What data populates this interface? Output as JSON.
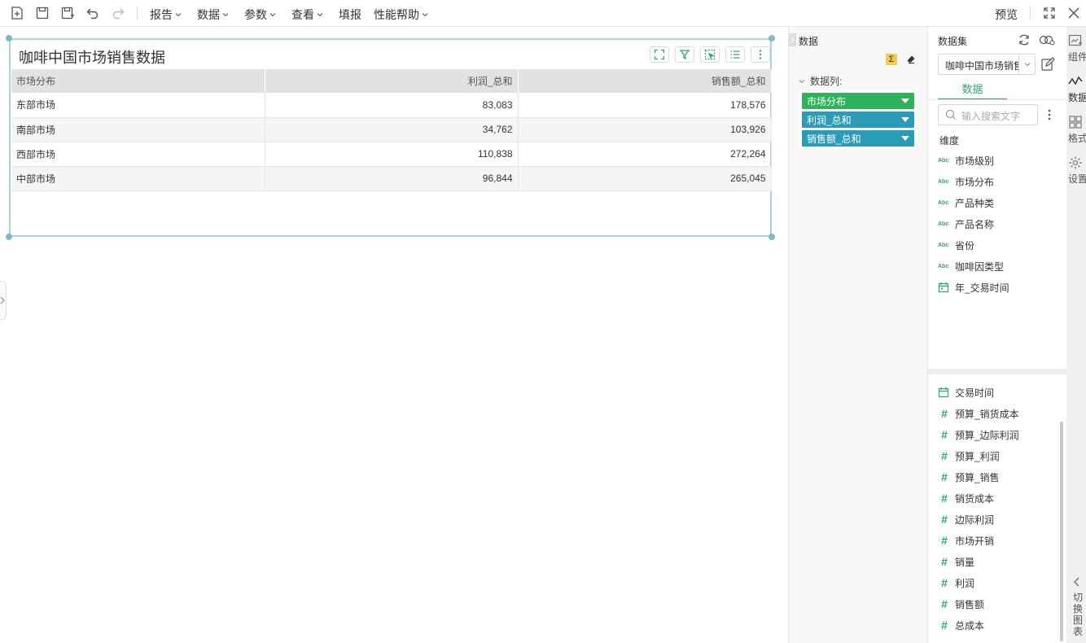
{
  "toolbar": {
    "menus": [
      {
        "label": "报告",
        "has_dropdown": true
      },
      {
        "label": "数据",
        "has_dropdown": true
      },
      {
        "label": "参数",
        "has_dropdown": true
      },
      {
        "label": "查看",
        "has_dropdown": true
      },
      {
        "label": "填报",
        "has_dropdown": false
      },
      {
        "label": "性能帮助",
        "has_dropdown": true
      }
    ],
    "icons": [
      "new-report-icon",
      "save-icon",
      "save-as-icon",
      "undo-icon",
      "redo-icon"
    ],
    "preview_label": "预览",
    "right_icons": [
      "fullscreen-icon",
      "close-icon"
    ]
  },
  "widget": {
    "title": "咖啡中国市场销售数据",
    "tools": [
      "expand-icon",
      "filter-icon",
      "select-icon",
      "list-icon",
      "more-icon"
    ],
    "table": {
      "columns": [
        "市场分布",
        "利润_总和",
        "销售额_总和"
      ],
      "rows": [
        [
          "东部市场",
          "83,083",
          "178,576"
        ],
        [
          "南部市场",
          "34,762",
          "103,926"
        ],
        [
          "西部市场",
          "110,838",
          "272,264"
        ],
        [
          "中部市场",
          "96,844",
          "265,045"
        ]
      ]
    }
  },
  "data_panel": {
    "title": "数据",
    "section_label": "数据列:",
    "pills": [
      {
        "label": "市场分布",
        "color": "#2fb25c"
      },
      {
        "label": "利润_总和",
        "color": "#2a9cb8"
      },
      {
        "label": "销售额_总和",
        "color": "#2a9cb8"
      }
    ],
    "sigma_label": "Σ"
  },
  "dataset_panel": {
    "title": "数据集",
    "selected_dataset": "咖啡中国市场销售",
    "tab_label": "数据",
    "search_placeholder": "输入搜索文字",
    "dimensions_label": "维度",
    "abc_label": "Abc",
    "dimensions": [
      {
        "label": "市场级别",
        "type": "text"
      },
      {
        "label": "市场分布",
        "type": "text"
      },
      {
        "label": "产品种类",
        "type": "text"
      },
      {
        "label": "产品名称",
        "type": "text"
      },
      {
        "label": "省份",
        "type": "text"
      },
      {
        "label": "咖啡因类型",
        "type": "text"
      },
      {
        "label": "年_交易时间",
        "type": "date"
      }
    ],
    "measures": [
      {
        "label": "交易时间",
        "type": "date"
      },
      {
        "label": "预算_销货成本",
        "type": "number"
      },
      {
        "label": "预算_边际利润",
        "type": "number"
      },
      {
        "label": "预算_利润",
        "type": "number"
      },
      {
        "label": "预算_销售",
        "type": "number"
      },
      {
        "label": "销货成本",
        "type": "number"
      },
      {
        "label": "边际利润",
        "type": "number"
      },
      {
        "label": "市场开销",
        "type": "number"
      },
      {
        "label": "销量",
        "type": "number"
      },
      {
        "label": "利润",
        "type": "number"
      },
      {
        "label": "销售额",
        "type": "number"
      },
      {
        "label": "总成本",
        "type": "number"
      }
    ]
  },
  "rail": {
    "items": [
      "组件",
      "数据",
      "格式",
      "设置"
    ],
    "switch_label": "切换图表"
  },
  "colors": {
    "accent_green": "#2ba47a",
    "pill_green": "#2fb25c",
    "pill_blue": "#2a9cb8",
    "widget_border": "#a9d3dc"
  }
}
